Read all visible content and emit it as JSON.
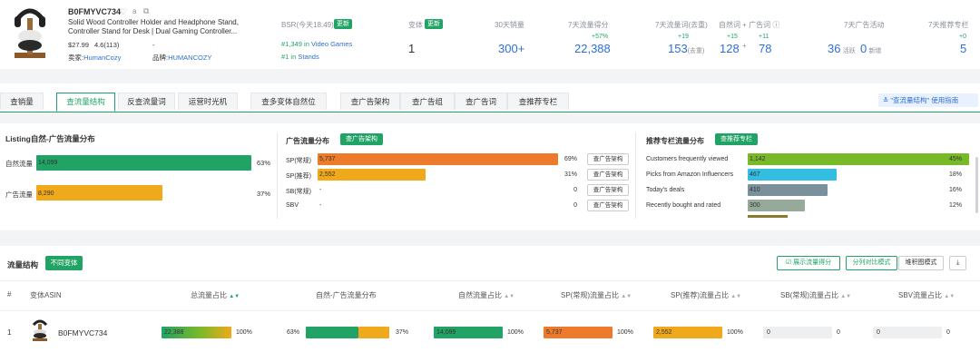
{
  "product": {
    "asin": "B0FMYVC734",
    "title_line1": "Solid Wood Controller Holder and Headphone Stand,",
    "title_line2": "Controller Stand for Desk | Dual Gaming Controller...",
    "price": "$27.99",
    "rating": "4.6(113)",
    "dash": "-",
    "seller_label": "卖家:",
    "seller": "HumanCozy",
    "brand_label": "品牌:",
    "brand": "HUMANCOZY",
    "bsr_label": "BSR(今天18:49)",
    "update_label": "更新",
    "rank1_prefix": "#1,349 in",
    "rank1_cat": "Video Games",
    "rank2_prefix": "#1 in",
    "rank2_cat": "Stands"
  },
  "stats": {
    "variants_label": "变体",
    "variants_update": "更新",
    "variants_value": "1",
    "sales_label": "30天销量",
    "sales_value": "300+",
    "traffic_label": "7天流量得分",
    "traffic_delta": "+57%",
    "traffic_value": "22,388",
    "kw_label": "7天流量词(去重)",
    "kw_delta": "+19",
    "kw_value": "153",
    "kw_unit": "(去重)",
    "natural_label": "自然词",
    "plus": "+",
    "ad_label": "广告词",
    "natural_delta": "+15",
    "natural_value": "128",
    "ad_delta": "+11",
    "ad_value": "78",
    "ads_label": "7天广告活动",
    "ads_active_value": "36",
    "ads_active_unit": "活跃",
    "ads_new_value": "0",
    "ads_new_unit": "新增",
    "rec_label": "7天推荐专栏",
    "rec_delta": "+0",
    "rec_value": "5"
  },
  "tabs": [
    "查销量",
    "查流量结构",
    "反查流量词",
    "运营时光机",
    "查多变体自然位",
    "查广告架构",
    "查广告组",
    "查广告词",
    "查推荐专栏"
  ],
  "guide_link": "\"查流量结构\" 使用指南",
  "listing": {
    "title": "Listing自然-广告流量分布",
    "rows": [
      {
        "label": "自然流量",
        "value": "14,099",
        "pct": "63%",
        "frac": 0.63
      },
      {
        "label": "广告流量",
        "value": "8,290",
        "pct": "37%",
        "frac": 0.37
      }
    ]
  },
  "ads": {
    "title": "广告流量分布",
    "button": "查广告架构",
    "rows": [
      {
        "label": "SP(常规)",
        "value": "5,737",
        "pct": "69%",
        "frac": 0.69,
        "btn": "查广告架构"
      },
      {
        "label": "SP(推荐)",
        "value": "2,552",
        "pct": "31%",
        "frac": 0.31,
        "btn": "查广告架构"
      },
      {
        "label": "SB(常规)",
        "value": "-",
        "pct": "0",
        "frac": 0,
        "btn": "查广告架构"
      },
      {
        "label": "SBV",
        "value": "-",
        "pct": "0",
        "frac": 0,
        "btn": "查广告架构"
      }
    ]
  },
  "rec": {
    "title": "推荐专栏流量分布",
    "button": "查推荐专栏",
    "rows": [
      {
        "label": "Customers frequently viewed",
        "value": "1,142",
        "pct": "45%",
        "frac": 1.0
      },
      {
        "label": "Picks from Amazon Influencers",
        "value": "467",
        "pct": "18%",
        "frac": 0.4
      },
      {
        "label": "Today's deals",
        "value": "410",
        "pct": "16%",
        "frac": 0.36
      },
      {
        "label": "Recently bought and rated",
        "value": "300",
        "pct": "12%",
        "frac": 0.26
      }
    ]
  },
  "structure": {
    "title": "流量结构",
    "btn_variant": "不同变体",
    "btn_show_score": "展示流量得分",
    "btn_compare": "分列对比模式",
    "btn_stack": "堆积图模式",
    "headers": [
      "#",
      "变体ASIN",
      "总流量占比",
      "自然-广告流量分布",
      "自然流量占比",
      "SP(常规)流量占比",
      "SP(推荐)流量占比",
      "SB(常规)流量占比",
      "SBV流量占比"
    ],
    "row": {
      "index": "1",
      "asin": "B0FMYVC734",
      "total_value": "22,388",
      "total_pct": "100%",
      "nat_pct": "63%",
      "ad_pct": "37%",
      "nat_split": 0.63,
      "natural_value": "14,099",
      "natural_pct": "100%",
      "spc_value": "5,737",
      "spc_pct": "100%",
      "spr_value": "2,552",
      "spr_pct": "100%",
      "sb_value": "0",
      "sb_pct": "0",
      "sbv_value": "0",
      "sbv_pct": "0"
    }
  },
  "colors": {
    "green": "#21a366",
    "orange": "#ee7b2b",
    "amber": "#f0a91b",
    "olive": "#78b928",
    "cyan": "#33bde0",
    "slate": "#7a919c",
    "sage": "#96aa9b",
    "link": "#2e6fd6"
  }
}
